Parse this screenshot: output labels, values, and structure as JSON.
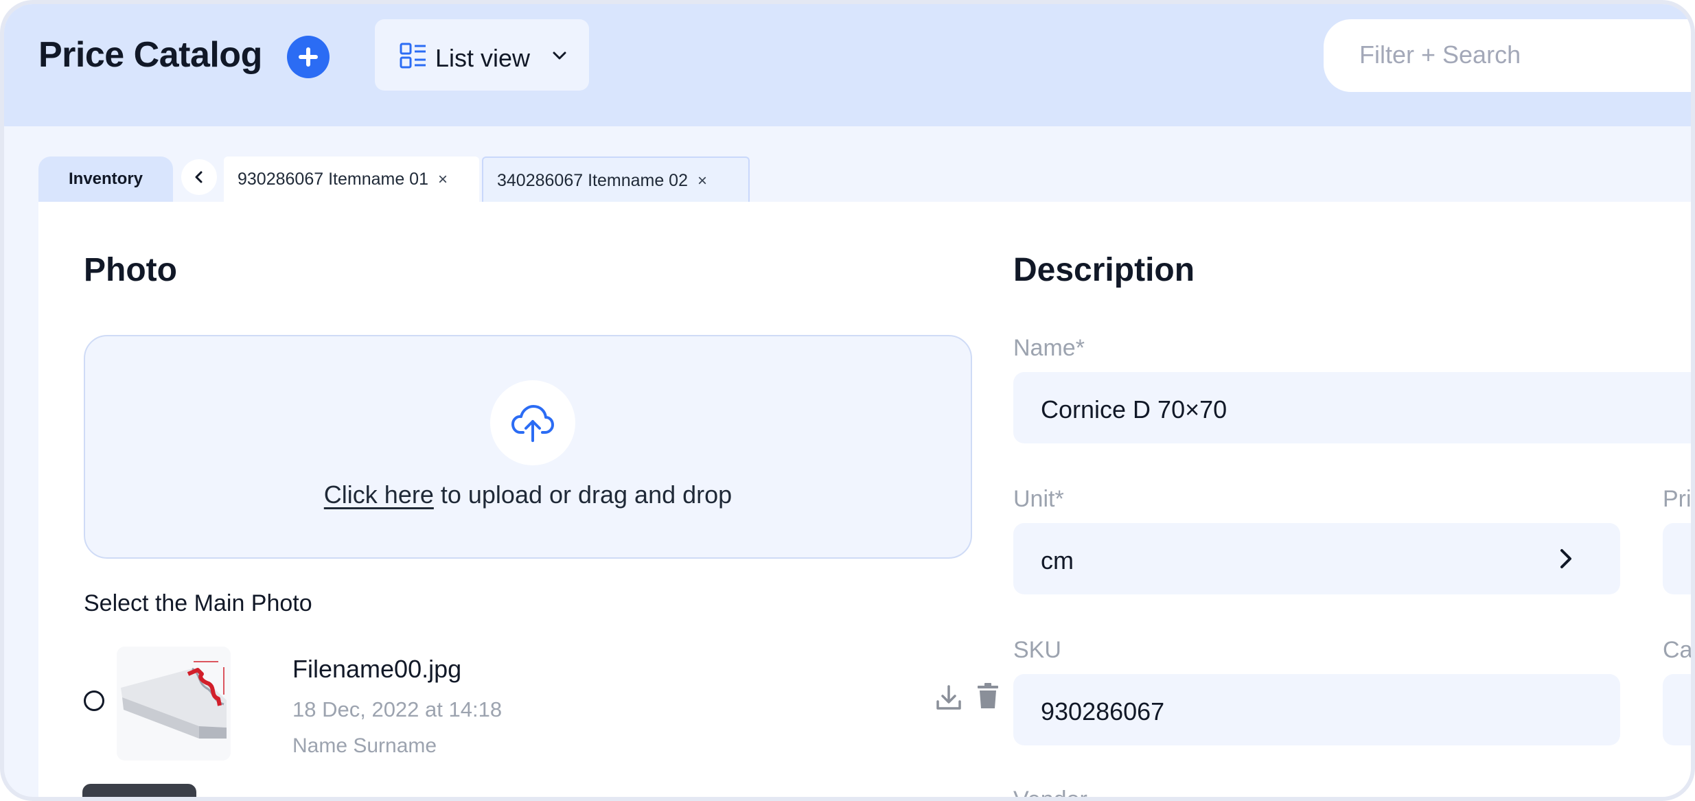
{
  "header": {
    "title": "Price Catalog",
    "view_label": "List view",
    "search_placeholder": "Filter + Search"
  },
  "tabs": {
    "inventory_label": "Inventory",
    "items": [
      {
        "label": "930286067 Itemname 01",
        "close": "×",
        "active": true
      },
      {
        "label": "340286067 Itemname 02",
        "close": "×",
        "active": false
      }
    ]
  },
  "photo": {
    "heading": "Photo",
    "upload_link": "Click here",
    "upload_rest": " to upload or drag and drop",
    "main_photo_label": "Select the Main Photo",
    "files": [
      {
        "name": "Filename00.jpg",
        "date": "18 Dec, 2022 at 14:18",
        "user": "Name Surname"
      }
    ]
  },
  "description": {
    "heading": "Description",
    "name_label": "Name*",
    "name_value": "Cornice D 70×70",
    "unit_label": "Unit*",
    "unit_value": "cm",
    "price_label_partial": "Pri",
    "sku_label": "SKU",
    "sku_value": "930286067",
    "category_label_partial": "Ca",
    "vendor_label_partial": "Vendor"
  },
  "colors": {
    "accent": "#2b6cf4",
    "header_bg": "#d9e5fd",
    "field_bg": "#f1f5fe"
  },
  "icons": [
    "plus-icon",
    "list-view-icon",
    "chevron-down-icon",
    "chevron-left-icon",
    "close-icon",
    "upload-cloud-icon",
    "download-icon",
    "trash-icon",
    "chevron-right-icon"
  ]
}
